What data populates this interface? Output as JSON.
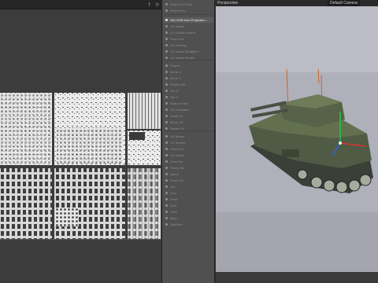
{
  "uv_panel": {
    "toolbar_icons": [
      "pin-icon",
      "refresh-icon"
    ]
  },
  "menu": {
    "items": [
      {
        "label": "Relax UVs Plus",
        "active": false
      },
      {
        "label": "Relax UVs",
        "active": false
      },
      {
        "label": "Set UVW from Projection...",
        "active": true
      },
      {
        "label": "UV Unfold",
        "active": false
      },
      {
        "label": "UV Unfold Archive",
        "active": false
      },
      {
        "label": "Pack UVs",
        "active": false
      },
      {
        "label": "UV Packing",
        "active": false
      },
      {
        "label": "UV Island Straighten",
        "active": false
      },
      {
        "label": "UV Island Stretch",
        "active": false
      },
      {
        "label": "Project",
        "active": false
      },
      {
        "label": "Mirror U",
        "active": false
      },
      {
        "label": "Mirror V",
        "active": false
      },
      {
        "label": "Rotate CW",
        "active": false
      },
      {
        "label": "Flip U",
        "active": false
      },
      {
        "label": "Flip V",
        "active": false
      },
      {
        "label": "Snap to Grid",
        "active": false
      },
      {
        "label": "UV Transform",
        "active": false
      },
      {
        "label": "Scale UV",
        "active": false
      },
      {
        "label": "Move UV",
        "active": false
      },
      {
        "label": "Rotate UV",
        "active": false
      },
      {
        "label": "UV Border",
        "active": false
      },
      {
        "label": "UV Seams",
        "active": false
      },
      {
        "label": "Select UV",
        "active": false
      },
      {
        "label": "UV Island",
        "active": false
      },
      {
        "label": "Grow Sel",
        "active": false
      },
      {
        "label": "Shrink Sel",
        "active": false
      },
      {
        "label": "Island",
        "active": false
      },
      {
        "label": "Reset UV",
        "active": false
      },
      {
        "label": "Cut",
        "active": false
      },
      {
        "label": "Sew",
        "active": false
      },
      {
        "label": "Weld",
        "active": false
      },
      {
        "label": "Split",
        "active": false
      },
      {
        "label": "Pack",
        "active": false
      },
      {
        "label": "Align",
        "active": false
      },
      {
        "label": "Optimize",
        "active": false
      }
    ]
  },
  "viewport": {
    "title": "Perspective",
    "camera": "Default Camera"
  }
}
